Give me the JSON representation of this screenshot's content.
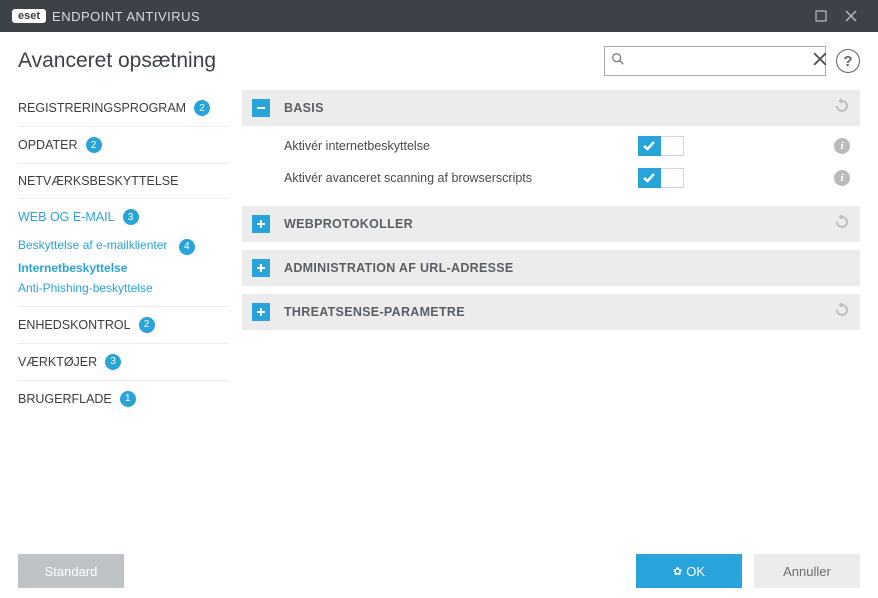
{
  "titlebar": {
    "brand": "eset",
    "product": "ENDPOINT ANTIVIRUS"
  },
  "page_title": "Avanceret opsætning",
  "search": {
    "placeholder": "",
    "value": ""
  },
  "nav": [
    {
      "label": "REGISTRERINGSPROGRAM",
      "badge": "2"
    },
    {
      "label": "OPDATER",
      "badge": "2"
    },
    {
      "label": "NETVÆRKSBESKYTTELSE",
      "badge": ""
    },
    {
      "label": "WEB OG E-MAIL",
      "badge": "3",
      "active": true
    },
    {
      "label": "ENHEDSKONTROL",
      "badge": "2"
    },
    {
      "label": "VÆRKTØJER",
      "badge": "3"
    },
    {
      "label": "BRUGERFLADE",
      "badge": "1"
    }
  ],
  "subnav": [
    {
      "label": "Beskyttelse af e-mailklienter",
      "badge": "4"
    },
    {
      "label": "Internetbeskyttelse",
      "selected": true
    },
    {
      "label": "Anti-Phishing-beskyttelse"
    }
  ],
  "sections": {
    "basis": {
      "title": "BASIS",
      "rows": [
        {
          "label": "Aktivér internetbeskyttelse",
          "on": true
        },
        {
          "label": "Aktivér avanceret scanning af browserscripts",
          "on": true
        }
      ]
    },
    "web": {
      "title": "WEBPROTOKOLLER"
    },
    "url": {
      "title": "ADMINISTRATION AF URL-ADRESSE"
    },
    "ts": {
      "title": "THREATSENSE-PARAMETRE"
    }
  },
  "footer": {
    "default": "Standard",
    "ok": "OK",
    "cancel": "Annuller"
  }
}
